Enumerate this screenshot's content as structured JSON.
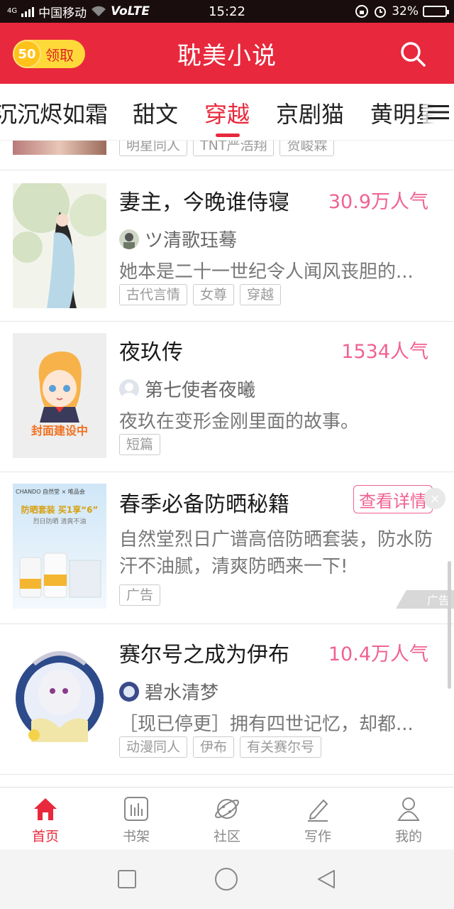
{
  "status_bar": {
    "network": "4G",
    "carrier": "中国移动",
    "volte": "VoLTE",
    "time": "15:22",
    "battery": "32%",
    "battery_level": 0.32
  },
  "header": {
    "coin_count": "50",
    "coin_label": "领取",
    "title": "耽美小说"
  },
  "tabs": [
    {
      "label": "沉沉烬如霜",
      "active": false
    },
    {
      "label": "甜文",
      "active": false
    },
    {
      "label": "穿越",
      "active": true
    },
    {
      "label": "京剧猫",
      "active": false
    },
    {
      "label": "黄明星",
      "active": false
    }
  ],
  "partial_item": {
    "tags": [
      "明星同人",
      "TNT严浩翔",
      "贺峻霖"
    ]
  },
  "items": [
    {
      "title": "妻主，今晚谁侍寝",
      "popularity": "30.9万人气",
      "author": "ツ清歌珏蓦",
      "description": "她本是二十一世纪令人闻风丧胆的...",
      "tags": [
        "古代言情",
        "女尊",
        "穿越"
      ]
    },
    {
      "title": "夜玖传",
      "popularity": "1534人气",
      "author": "第七使者夜曦",
      "description": "夜玖在变形金刚里面的故事。",
      "tags": [
        "短篇"
      ],
      "cover_text": "封面建设中"
    },
    {
      "title": "赛尔号之成为伊布",
      "popularity": "10.4万人气",
      "author": "碧水清梦",
      "description": "［现已停更］拥有四世记忆，却都...",
      "tags": [
        "动漫同人",
        "伊布",
        "有关赛尔号"
      ]
    }
  ],
  "ad": {
    "title": "春季必备防晒秘籍",
    "cta": "查看详情",
    "close": "×",
    "description": "自然堂烈日广谱高倍防晒套装，防水防汗不油腻，清爽防晒来一下!",
    "tag": "广告",
    "badge": "广告",
    "cover_brand": "CHANDO 自然堂 × 唯品会",
    "cover_promo": "防晒套装 买1享“6”",
    "cover_sub": "烈日防晒 清爽不油"
  },
  "bottom_nav": [
    {
      "label": "首页",
      "icon": "home-icon",
      "active": true
    },
    {
      "label": "书架",
      "icon": "bookshelf-icon",
      "active": false
    },
    {
      "label": "社区",
      "icon": "planet-icon",
      "active": false
    },
    {
      "label": "写作",
      "icon": "pen-icon",
      "active": false
    },
    {
      "label": "我的",
      "icon": "profile-icon",
      "active": false
    }
  ],
  "colors": {
    "brand_red": "#e8283c",
    "popularity_pink": "#f06292",
    "coin_yellow": "#ffd93a"
  }
}
